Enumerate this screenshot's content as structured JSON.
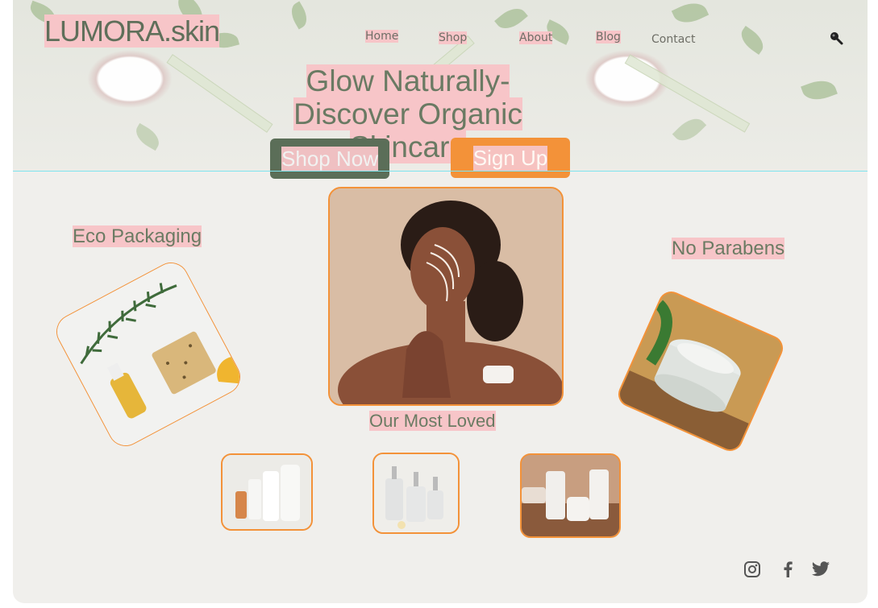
{
  "brand": {
    "logo": "LUMORA.skin"
  },
  "nav": {
    "items": [
      {
        "label": "Home"
      },
      {
        "label": "Shop"
      },
      {
        "label": "About"
      },
      {
        "label": "Blog"
      },
      {
        "label": "Contact"
      }
    ],
    "search_icon": "search-icon"
  },
  "hero": {
    "title_line1": "Glow Naturally-",
    "title_line2": "Discover Organic Skincare",
    "shop_button": "Shop Now",
    "signup_button": "Sign Up"
  },
  "features": {
    "left": "Eco Packaging",
    "right": "No Parabens"
  },
  "products": {
    "heading": "Our Most Loved"
  },
  "social": {
    "icons": [
      "instagram-icon",
      "facebook-icon",
      "twitter-icon"
    ]
  },
  "colors": {
    "sage": "#5b6e58",
    "orange": "#f39239",
    "pink_highlight": "#f7c5c8",
    "background": "#f0efec"
  }
}
